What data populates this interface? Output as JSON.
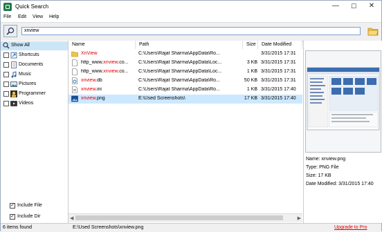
{
  "window": {
    "title": "Quick Search",
    "controls": {
      "minimize": "—",
      "maximize": "☐",
      "close": "✕"
    }
  },
  "menu": [
    "File",
    "Edit",
    "View",
    "Help"
  ],
  "search": {
    "value": "xnview"
  },
  "categories": [
    {
      "label": "Show All",
      "icon": "search-all-icon",
      "selected": true
    },
    {
      "label": "Shortcuts",
      "icon": "shortcut-icon"
    },
    {
      "label": "Documents",
      "icon": "document-icon"
    },
    {
      "label": "Music",
      "icon": "music-icon"
    },
    {
      "label": "Pictures",
      "icon": "picture-icon"
    },
    {
      "label": "Programmer",
      "icon": "programmer-icon"
    },
    {
      "label": "Videos",
      "icon": "video-icon"
    }
  ],
  "options": {
    "include_file": "Include File",
    "include_dir": "Include Dir"
  },
  "table": {
    "headers": {
      "name": "Name",
      "path": "Path",
      "size": "Size",
      "date": "Date Modified"
    },
    "rows": [
      {
        "name_pre": "",
        "name_hl": "XnView",
        "name_post": "",
        "path": "C:\\Users\\Rajat Sharma\\AppData\\Ro...",
        "size": "",
        "date": "3/31/2015 17:31",
        "icon": "folder-icon"
      },
      {
        "name_pre": "http_www.",
        "name_hl": "xnview",
        "name_post": ".co...",
        "path": "C:\\Users\\Rajat Sharma\\AppData\\Loc...",
        "size": "3 KB",
        "date": "3/31/2015 17:31",
        "icon": "file-icon"
      },
      {
        "name_pre": "http_www.",
        "name_hl": "xnview",
        "name_post": ".co...",
        "path": "C:\\Users\\Rajat Sharma\\AppData\\Loc...",
        "size": "1 KB",
        "date": "3/31/2015 17:31",
        "icon": "file-icon"
      },
      {
        "name_pre": "",
        "name_hl": "xnview",
        "name_post": ".db",
        "path": "C:\\Users\\Rajat Sharma\\AppData\\Ro...",
        "size": "50 KB",
        "date": "3/31/2015 17:31",
        "icon": "db-icon"
      },
      {
        "name_pre": "",
        "name_hl": "xnview",
        "name_post": ".ini",
        "path": "C:\\Users\\Rajat Sharma\\AppData\\Ro...",
        "size": "1 KB",
        "date": "3/31/2015 17:40",
        "icon": "ini-icon"
      },
      {
        "name_pre": "",
        "name_hl": "xnview",
        "name_post": ".png",
        "path": "E:\\Used Screenshots\\",
        "size": "17 KB",
        "date": "3/31/2015 17:40",
        "icon": "image-icon",
        "selected": true
      }
    ]
  },
  "preview": {
    "name": "Name: xnview.png",
    "type": "Type: PNG File",
    "size": "Size: 17 KB",
    "date": "Date Modified: 3/31/2015 17:40"
  },
  "status": {
    "count": "6 items found",
    "path": "E:\\Used Screenshots\\xnview.png",
    "upgrade": "Upgrade to Pro"
  },
  "colors": {
    "highlight": "#dd0000",
    "selection": "#cce8ff",
    "accent": "#1f7a4d"
  }
}
